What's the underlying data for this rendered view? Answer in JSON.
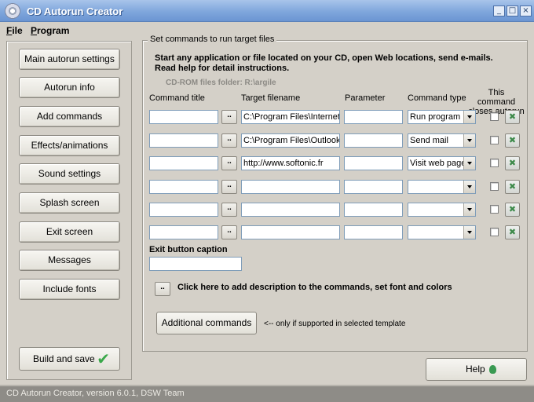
{
  "window": {
    "title": "CD Autorun Creator"
  },
  "menu": [
    {
      "key": "F",
      "rest": "ile"
    },
    {
      "key": "P",
      "rest": "rogram"
    }
  ],
  "sidebar": {
    "items": [
      "Main autorun settings",
      "Autorun info",
      "Add commands",
      "Effects/animations",
      "Sound settings",
      "Splash screen",
      "Exit screen",
      "Messages",
      "Include fonts"
    ],
    "build_label": "Build and save"
  },
  "group": {
    "legend": "Set commands to run target files",
    "info_line1": "Start any application or file located on your CD, open Web locations, send e-mails.",
    "info_line2": "Read help for detail instructions.",
    "folder": "CD-ROM files folder: R:\\argile"
  },
  "columns": {
    "title": "Command title",
    "target": "Target filename",
    "param": "Parameter",
    "type": "Command type",
    "closes_line1": "This command",
    "closes_line2": "closes autorun"
  },
  "rows": [
    {
      "title": "",
      "target": "C:\\Program Files\\Internet E",
      "param": "",
      "type": "Run program",
      "closes": false
    },
    {
      "title": "",
      "target": "C:\\Program Files\\Outlook E",
      "param": "",
      "type": "Send mail",
      "closes": false
    },
    {
      "title": "",
      "target": "http://www.softonic.fr",
      "param": "",
      "type": "Visit web page",
      "closes": false
    },
    {
      "title": "",
      "target": "",
      "param": "",
      "type": "",
      "closes": false
    },
    {
      "title": "",
      "target": "",
      "param": "",
      "type": "",
      "closes": false
    },
    {
      "title": "",
      "target": "",
      "param": "",
      "type": "",
      "closes": false
    }
  ],
  "browse_label": "..",
  "delete_icon": "remove-command-icon",
  "exit_caption": {
    "label": "Exit button caption",
    "value": ""
  },
  "description": {
    "button": "..",
    "text": "Click here to add description to the commands, set font and colors"
  },
  "additional": {
    "label": "Additional commands",
    "note": "<-- only if supported in selected template"
  },
  "help": {
    "label": "Help"
  },
  "status": "CD Autorun Creator, version 6.0.1, DSW Team"
}
